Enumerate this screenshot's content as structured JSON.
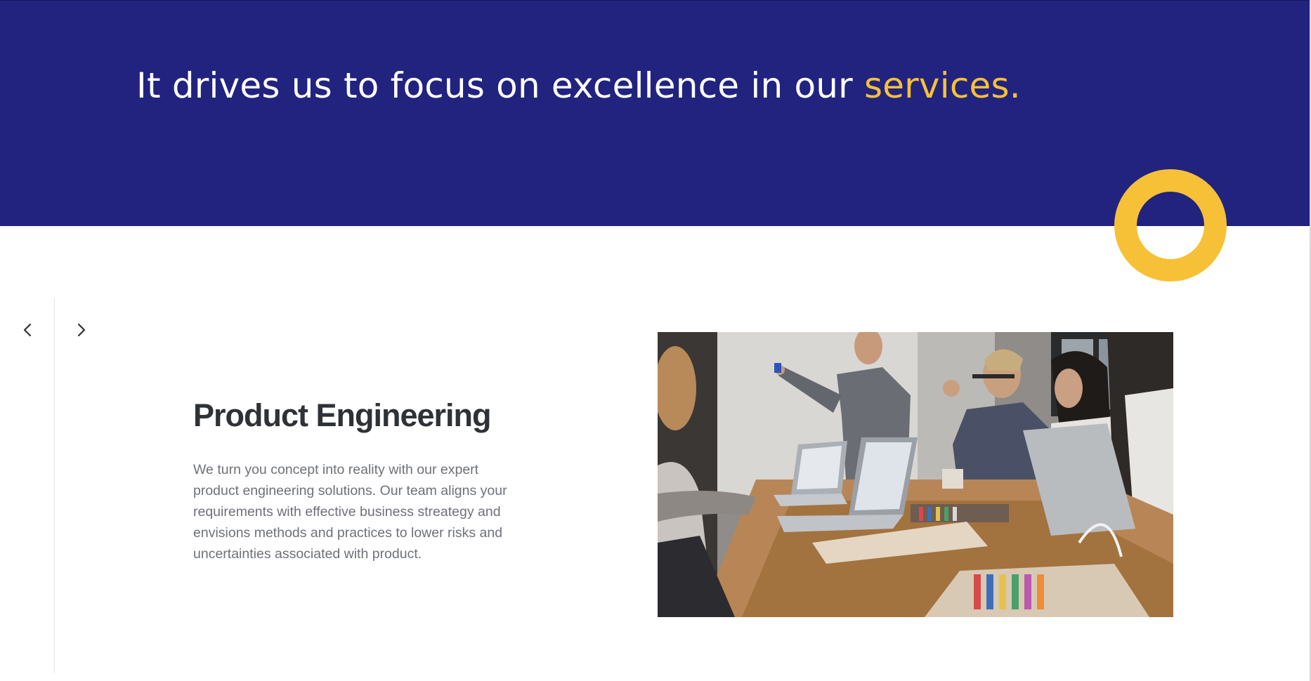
{
  "hero": {
    "heading_main": "It drives us to focus on excellence in our ",
    "heading_accent": "services.",
    "background_color": "#21237f",
    "accent_color": "#f7c137"
  },
  "decoration": {
    "ring_icon": "ring-circle",
    "ring_color": "#f7c137"
  },
  "carousel": {
    "prev_icon": "chevron-left-icon",
    "next_icon": "chevron-right-icon",
    "slide": {
      "title": "Product Engineering",
      "description": "We turn you concept into reality with our expert product engineering solutions. Our team aligns your requirements with effective business streategy and envisions methods and practices to lower risks and uncertainties associated with product.",
      "image_subject": "team-meeting-photo"
    }
  }
}
